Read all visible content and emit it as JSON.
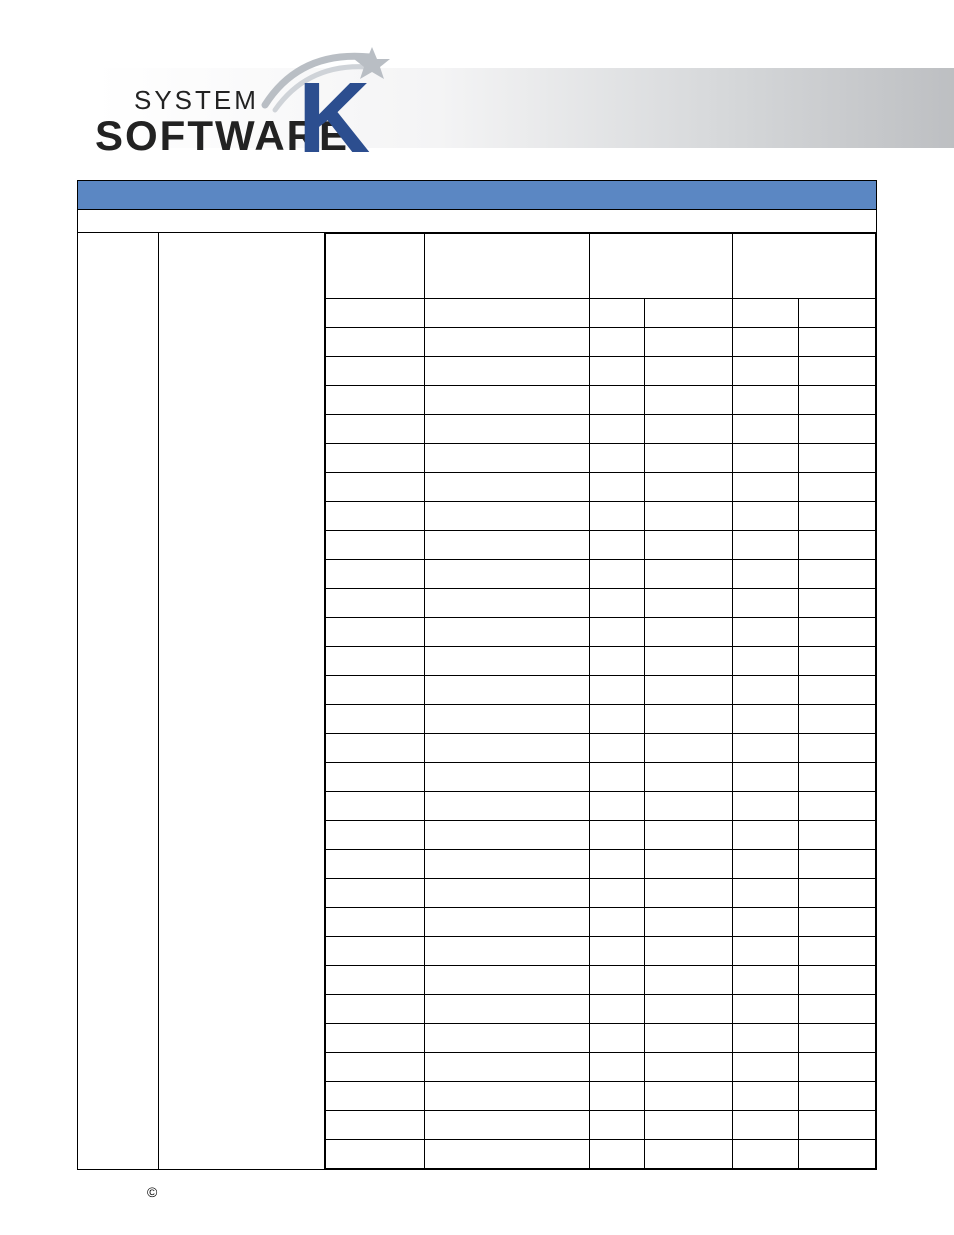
{
  "logo": {
    "line1": "SYSTEM",
    "line2": "SOFTWARE",
    "mark": "K"
  },
  "title_bar": "",
  "sub_bar": "",
  "left_col": "",
  "mid_col": "",
  "table": {
    "headers": [
      "",
      "",
      "",
      "",
      "",
      ""
    ],
    "row_count": 30
  },
  "footer": {
    "copyright_symbol": "©"
  }
}
